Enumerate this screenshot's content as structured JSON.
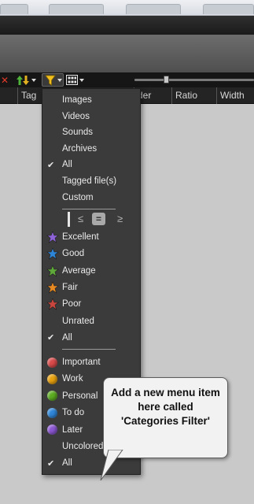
{
  "toolbar": {
    "close_glyph": "✕",
    "sort_icon": "sort-arrows-icon",
    "filter_icon": "filter-funnel-icon",
    "view_icon": "grid-view-icon"
  },
  "columns": [
    "",
    "Tag",
    "der",
    "Ratio",
    "Width"
  ],
  "menu": {
    "type_items": [
      {
        "label": "Images",
        "checked": false
      },
      {
        "label": "Videos",
        "checked": false
      },
      {
        "label": "Sounds",
        "checked": false
      },
      {
        "label": "Archives",
        "checked": false
      },
      {
        "label": "All",
        "checked": true
      },
      {
        "label": "Tagged file(s)",
        "checked": false
      },
      {
        "label": "Custom",
        "checked": false
      }
    ],
    "compare": {
      "le": "≤",
      "eq": "=",
      "ge": "≥"
    },
    "rating_items": [
      {
        "label": "Excellent",
        "star_color": "#8e63d8",
        "checked": false
      },
      {
        "label": "Good",
        "star_color": "#2e86d8",
        "checked": false
      },
      {
        "label": "Average",
        "star_color": "#5fa83a",
        "checked": false
      },
      {
        "label": "Fair",
        "star_color": "#e88a22",
        "checked": false
      },
      {
        "label": "Poor",
        "star_color": "#c9463e",
        "checked": false
      },
      {
        "label": "Unrated",
        "star_color": "",
        "checked": false
      },
      {
        "label": "All",
        "star_color": "",
        "checked": true
      }
    ],
    "color_items": [
      {
        "label": "Important",
        "color": "#d94a4a",
        "checked": false
      },
      {
        "label": "Work",
        "color": "#e9a20f",
        "checked": false
      },
      {
        "label": "Personal",
        "color": "#5cac21",
        "checked": false
      },
      {
        "label": "To do",
        "color": "#2f86d8",
        "checked": false
      },
      {
        "label": "Later",
        "color": "#8b57d2",
        "checked": false
      },
      {
        "label": "Uncolored",
        "color": "",
        "checked": false
      },
      {
        "label": "All",
        "color": "",
        "checked": true
      }
    ]
  },
  "callout": {
    "text": "Add a new menu item here called 'Categories Filter'"
  }
}
